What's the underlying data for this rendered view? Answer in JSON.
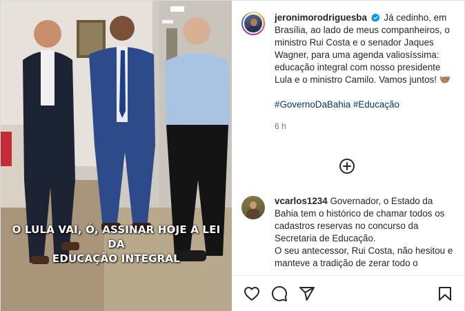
{
  "post": {
    "author": {
      "username": "jeronimorodriguesba",
      "verified": true
    },
    "caption_text": "Já cedinho, em Brasília, ao lado de meus companheiros, o ministro Rui Costa e o senador Jaques Wagner, para uma agenda valiosíssima: educação integral com nosso presidente Lula e o ministro Camilo. Vamos juntos! 🤝🏽",
    "hashtags": [
      "#GovernoDaBahia",
      "#Educação"
    ],
    "time_ago": "6 h",
    "media_overlay_line1": "O LULA VAI, Ó, ASSINAR HOJE A LEI DA",
    "media_overlay_line2": "EDUCAÇÃO INTEGRAL"
  },
  "comments": [
    {
      "username": "vcarlos1234",
      "text": "Governador, o Estado da Bahia tem o histórico de chamar todos os cadastros reservas no concurso da Secretaria de Educação.",
      "text_continued": "O seu antecessor, Rui Costa, não hesitou e manteve a tradição de zerar todo o"
    }
  ],
  "icons": {
    "load_more": "plus-circle-icon",
    "like": "heart-icon",
    "comment": "comment-icon",
    "share": "send-icon",
    "save": "bookmark-icon",
    "verified": "verified-badge-icon"
  },
  "colors": {
    "verified_blue": "#0095f6",
    "hashtag_link": "#00376b",
    "text_primary": "#262626",
    "text_secondary": "#737373"
  }
}
